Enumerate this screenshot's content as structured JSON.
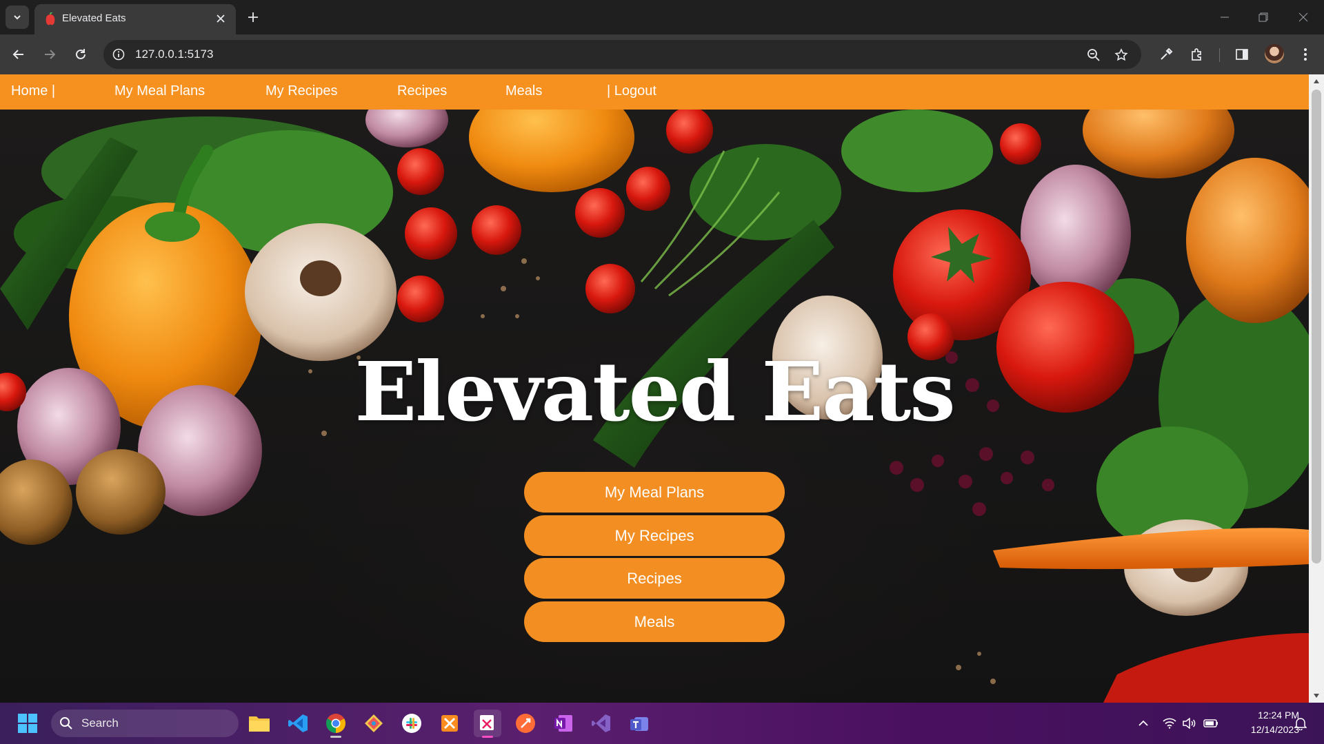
{
  "browser": {
    "tab": {
      "title": "Elevated Eats"
    },
    "address": {
      "url": "127.0.0.1:5173"
    }
  },
  "site": {
    "nav": {
      "home": "Home |",
      "my_meal_plans": "My Meal Plans",
      "my_recipes": "My Recipes",
      "recipes": "Recipes",
      "meals": "Meals",
      "logout": "| Logout"
    },
    "hero_title": "Elevated Eats",
    "buttons": {
      "my_meal_plans": "My Meal Plans",
      "my_recipes": "My Recipes",
      "recipes": "Recipes",
      "meals": "Meals"
    },
    "colors": {
      "accent": "#f6901e",
      "button": "#f28e22"
    }
  },
  "taskbar": {
    "search_label": "Search",
    "time": "12:24 PM",
    "date": "12/14/2023",
    "apps": [
      "windows-start-icon",
      "file-explorer-icon",
      "vscode-icon",
      "chrome-icon",
      "git-icon",
      "slack-icon",
      "xampp-icon",
      "snipping-tool-icon",
      "postman-icon",
      "onenote-icon",
      "visual-studio-icon",
      "teams-icon"
    ]
  }
}
